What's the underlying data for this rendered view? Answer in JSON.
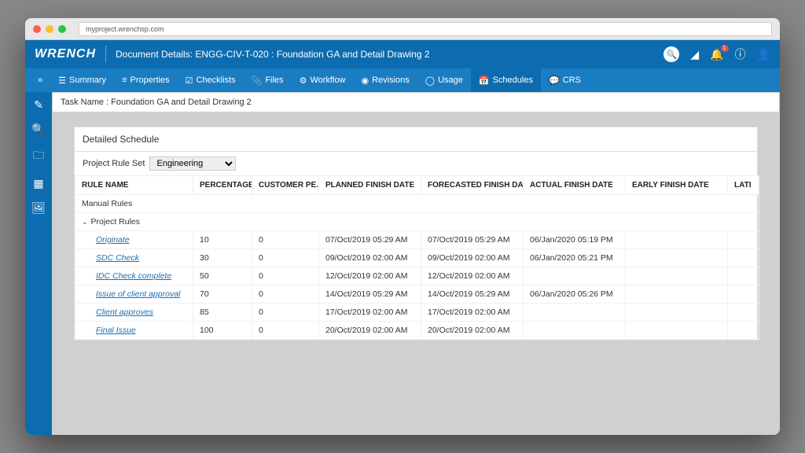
{
  "browser": {
    "url": "myproject.wrenchsp.com"
  },
  "header": {
    "logo": "WRENCH",
    "title": "Document Details: ENGG-CIV-T-020 : Foundation GA and Detail Drawing 2",
    "notification_count": "1"
  },
  "tabs": [
    {
      "label": "Summary"
    },
    {
      "label": "Properties"
    },
    {
      "label": "Checklists"
    },
    {
      "label": "Files"
    },
    {
      "label": "Workflow"
    },
    {
      "label": "Revisions"
    },
    {
      "label": "Usage"
    },
    {
      "label": "Schedules"
    },
    {
      "label": "CRS"
    }
  ],
  "taskname_label": "Task Name : Foundation GA and Detail Drawing 2",
  "panel": {
    "heading": "Detailed Schedule",
    "ruleset_label": "Project Rule Set",
    "ruleset_value": "Engineering"
  },
  "columns": [
    "RULE NAME",
    "PERCENTAGE",
    "CUSTOMER PE...",
    "PLANNED FINISH DATE",
    "FORECASTED FINISH DATE",
    "ACTUAL FINISH DATE",
    "EARLY FINISH DATE",
    "LATI"
  ],
  "groups": {
    "manual": "Manual Rules",
    "project": "Project Rules"
  },
  "rows": [
    {
      "name": "Originate",
      "pct": "10",
      "cust": "0",
      "planned": "07/Oct/2019 05:29 AM",
      "forecast": "07/Oct/2019 05:29 AM",
      "actual": "06/Jan/2020 05:19 PM",
      "early": ""
    },
    {
      "name": "SDC Check",
      "pct": "30",
      "cust": "0",
      "planned": "09/Oct/2019 02:00 AM",
      "forecast": "09/Oct/2019 02:00 AM",
      "actual": "06/Jan/2020 05:21 PM",
      "early": ""
    },
    {
      "name": "IDC Check complete",
      "pct": "50",
      "cust": "0",
      "planned": "12/Oct/2019 02:00 AM",
      "forecast": "12/Oct/2019 02:00 AM",
      "actual": "",
      "early": ""
    },
    {
      "name": "Issue of client approval",
      "pct": "70",
      "cust": "0",
      "planned": "14/Oct/2019 05:29 AM",
      "forecast": "14/Oct/2019 05:29 AM",
      "actual": "06/Jan/2020 05:26 PM",
      "early": ""
    },
    {
      "name": "Client approves",
      "pct": "85",
      "cust": "0",
      "planned": "17/Oct/2019 02:00 AM",
      "forecast": "17/Oct/2019 02:00 AM",
      "actual": "",
      "early": ""
    },
    {
      "name": "Final Issue",
      "pct": "100",
      "cust": "0",
      "planned": "20/Oct/2019 02:00 AM",
      "forecast": "20/Oct/2019 02:00 AM",
      "actual": "",
      "early": ""
    }
  ]
}
